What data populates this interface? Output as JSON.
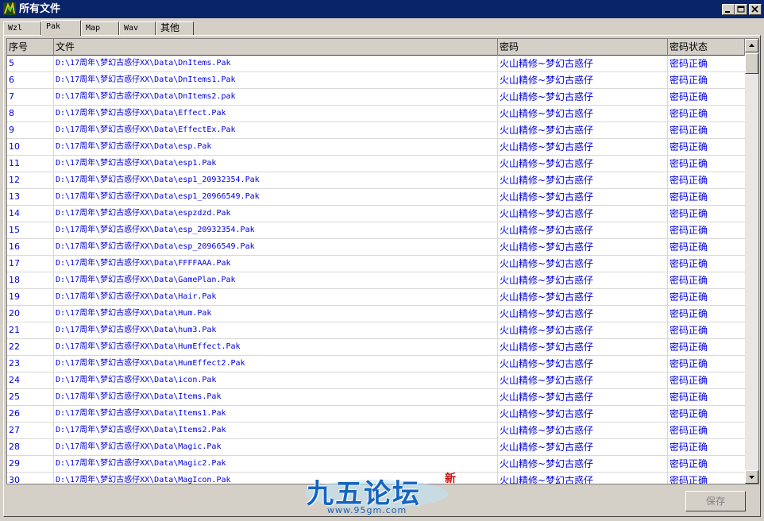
{
  "window": {
    "title": "所有文件",
    "accent": "#0a246a"
  },
  "tabs": [
    {
      "label": "Wzl",
      "active": false
    },
    {
      "label": "Pak",
      "active": true
    },
    {
      "label": "Map",
      "active": false
    },
    {
      "label": "Wav",
      "active": false
    },
    {
      "label": "其他",
      "active": false
    }
  ],
  "table": {
    "columns": [
      "序号",
      "文件",
      "密码",
      "密码状态"
    ],
    "text_color": "#0000e0",
    "rows": [
      {
        "index": "5",
        "file": "D:\\17周年\\梦幻古惑仔XX\\Data\\DnItems.Pak",
        "password": "火山精修~梦幻古惑仔",
        "status": "密码正确"
      },
      {
        "index": "6",
        "file": "D:\\17周年\\梦幻古惑仔XX\\Data\\DnItems1.Pak",
        "password": "火山精修~梦幻古惑仔",
        "status": "密码正确"
      },
      {
        "index": "7",
        "file": "D:\\17周年\\梦幻古惑仔XX\\Data\\DnItems2.pak",
        "password": "火山精修~梦幻古惑仔",
        "status": "密码正确"
      },
      {
        "index": "8",
        "file": "D:\\17周年\\梦幻古惑仔XX\\Data\\Effect.Pak",
        "password": "火山精修~梦幻古惑仔",
        "status": "密码正确"
      },
      {
        "index": "9",
        "file": "D:\\17周年\\梦幻古惑仔XX\\Data\\EffectEx.Pak",
        "password": "火山精修~梦幻古惑仔",
        "status": "密码正确"
      },
      {
        "index": "10",
        "file": "D:\\17周年\\梦幻古惑仔XX\\Data\\esp.Pak",
        "password": "火山精修~梦幻古惑仔",
        "status": "密码正确"
      },
      {
        "index": "11",
        "file": "D:\\17周年\\梦幻古惑仔XX\\Data\\esp1.Pak",
        "password": "火山精修~梦幻古惑仔",
        "status": "密码正确"
      },
      {
        "index": "12",
        "file": "D:\\17周年\\梦幻古惑仔XX\\Data\\esp1_20932354.Pak",
        "password": "火山精修~梦幻古惑仔",
        "status": "密码正确"
      },
      {
        "index": "13",
        "file": "D:\\17周年\\梦幻古惑仔XX\\Data\\esp1_20966549.Pak",
        "password": "火山精修~梦幻古惑仔",
        "status": "密码正确"
      },
      {
        "index": "14",
        "file": "D:\\17周年\\梦幻古惑仔XX\\Data\\espzdzd.Pak",
        "password": "火山精修~梦幻古惑仔",
        "status": "密码正确"
      },
      {
        "index": "15",
        "file": "D:\\17周年\\梦幻古惑仔XX\\Data\\esp_20932354.Pak",
        "password": "火山精修~梦幻古惑仔",
        "status": "密码正确"
      },
      {
        "index": "16",
        "file": "D:\\17周年\\梦幻古惑仔XX\\Data\\esp_20966549.Pak",
        "password": "火山精修~梦幻古惑仔",
        "status": "密码正确"
      },
      {
        "index": "17",
        "file": "D:\\17周年\\梦幻古惑仔XX\\Data\\FFFFAAA.Pak",
        "password": "火山精修~梦幻古惑仔",
        "status": "密码正确"
      },
      {
        "index": "18",
        "file": "D:\\17周年\\梦幻古惑仔XX\\Data\\GamePlan.Pak",
        "password": "火山精修~梦幻古惑仔",
        "status": "密码正确"
      },
      {
        "index": "19",
        "file": "D:\\17周年\\梦幻古惑仔XX\\Data\\Hair.Pak",
        "password": "火山精修~梦幻古惑仔",
        "status": "密码正确"
      },
      {
        "index": "20",
        "file": "D:\\17周年\\梦幻古惑仔XX\\Data\\Hum.Pak",
        "password": "火山精修~梦幻古惑仔",
        "status": "密码正确"
      },
      {
        "index": "21",
        "file": "D:\\17周年\\梦幻古惑仔XX\\Data\\hum3.Pak",
        "password": "火山精修~梦幻古惑仔",
        "status": "密码正确"
      },
      {
        "index": "22",
        "file": "D:\\17周年\\梦幻古惑仔XX\\Data\\HumEffect.Pak",
        "password": "火山精修~梦幻古惑仔",
        "status": "密码正确"
      },
      {
        "index": "23",
        "file": "D:\\17周年\\梦幻古惑仔XX\\Data\\HumEffect2.Pak",
        "password": "火山精修~梦幻古惑仔",
        "status": "密码正确"
      },
      {
        "index": "24",
        "file": "D:\\17周年\\梦幻古惑仔XX\\Data\\icon.Pak",
        "password": "火山精修~梦幻古惑仔",
        "status": "密码正确"
      },
      {
        "index": "25",
        "file": "D:\\17周年\\梦幻古惑仔XX\\Data\\Items.Pak",
        "password": "火山精修~梦幻古惑仔",
        "status": "密码正确"
      },
      {
        "index": "26",
        "file": "D:\\17周年\\梦幻古惑仔XX\\Data\\Items1.Pak",
        "password": "火山精修~梦幻古惑仔",
        "status": "密码正确"
      },
      {
        "index": "27",
        "file": "D:\\17周年\\梦幻古惑仔XX\\Data\\Items2.Pak",
        "password": "火山精修~梦幻古惑仔",
        "status": "密码正确"
      },
      {
        "index": "28",
        "file": "D:\\17周年\\梦幻古惑仔XX\\Data\\Magic.Pak",
        "password": "火山精修~梦幻古惑仔",
        "status": "密码正确"
      },
      {
        "index": "29",
        "file": "D:\\17周年\\梦幻古惑仔XX\\Data\\Magic2.Pak",
        "password": "火山精修~梦幻古惑仔",
        "status": "密码正确"
      },
      {
        "index": "30",
        "file": "D:\\17周年\\梦幻古惑仔XX\\Data\\MagIcon.Pak",
        "password": "火山精修~梦幻古惑仔",
        "status": "密码正确"
      }
    ]
  },
  "footer": {
    "save_label": "保存"
  },
  "watermark": {
    "brand": "九五论坛",
    "url": "www.95gm.com",
    "badge": "新"
  },
  "icons": {
    "app": "app-logo-icon",
    "minimize": "minimize-icon",
    "maximize": "maximize-icon",
    "close": "close-icon",
    "scroll_up": "arrow-up-icon",
    "scroll_down": "arrow-down-icon"
  }
}
